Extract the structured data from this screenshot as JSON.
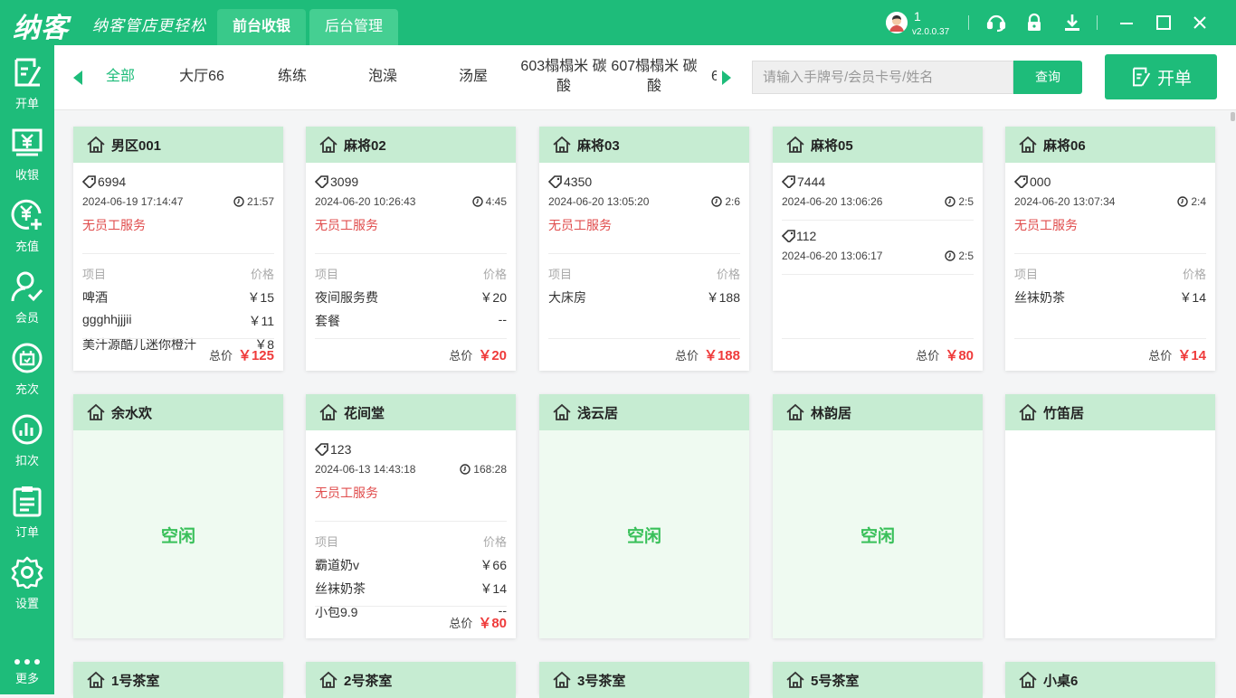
{
  "app": {
    "logo": "纳客",
    "slogan": "纳客管店更轻松",
    "version": "v2.0.0.37",
    "user": "1"
  },
  "main_tabs": [
    {
      "label": "前台收银"
    },
    {
      "label": "后台管理"
    }
  ],
  "sidebar": {
    "items": [
      {
        "label": "开单",
        "icon": "edit-note-icon"
      },
      {
        "label": "收银",
        "icon": "cashier-icon"
      },
      {
        "label": "充值",
        "icon": "recharge-icon"
      },
      {
        "label": "会员",
        "icon": "member-icon"
      },
      {
        "label": "充次",
        "icon": "recharge-times-icon"
      },
      {
        "label": "扣次",
        "icon": "deduct-times-icon"
      },
      {
        "label": "订单",
        "icon": "orders-icon"
      },
      {
        "label": "设置",
        "icon": "settings-icon"
      },
      {
        "label": "更多",
        "icon": "more-icon"
      }
    ]
  },
  "categories": [
    {
      "label": "全部"
    },
    {
      "label": "大厅66"
    },
    {
      "label": "练练"
    },
    {
      "label": "泡澡"
    },
    {
      "label": "汤屋"
    },
    {
      "label": "603榻榻米 碳酸"
    },
    {
      "label": "607榻榻米 碳酸"
    },
    {
      "label": "6"
    }
  ],
  "search": {
    "placeholder": "请输入手牌号/会员卡号/姓名",
    "button": "查询"
  },
  "open_order": {
    "label": "开单"
  },
  "labels": {
    "item": "项目",
    "price": "价格",
    "total": "总价",
    "no_staff": "无员工服务",
    "idle": "空闲"
  },
  "cards": [
    {
      "name": "男区001",
      "tag": "6994",
      "datetime": "2024-06-19 17:14:47",
      "duration": "21:57",
      "staff": "无员工服务",
      "items": [
        {
          "name": "啤酒",
          "price": "￥15"
        },
        {
          "name": "ggghhjjjii",
          "price": "￥11"
        },
        {
          "name": "美汁源酷儿迷你橙汁",
          "price": "￥8"
        }
      ],
      "total": "￥125"
    },
    {
      "name": "麻将02",
      "tag": "3099",
      "datetime": "2024-06-20 10:26:43",
      "duration": "4:45",
      "staff": "无员工服务",
      "items": [
        {
          "name": "夜间服务费",
          "price": "￥20"
        },
        {
          "name": "套餐",
          "price": "--"
        }
      ],
      "total": "￥20"
    },
    {
      "name": "麻将03",
      "tag": "4350",
      "datetime": "2024-06-20 13:05:20",
      "duration": "2:6",
      "staff": "无员工服务",
      "items": [
        {
          "name": "大床房",
          "price": "￥188"
        }
      ],
      "total": "￥188"
    },
    {
      "name": "麻将05",
      "tag": "7444",
      "datetime": "2024-06-20 13:06:26",
      "duration": "2:5",
      "tag2": "112",
      "datetime2": "2024-06-20 13:06:17",
      "duration2": "2:5",
      "total": "￥80"
    },
    {
      "name": "麻将06",
      "tag": "000",
      "datetime": "2024-06-20 13:07:34",
      "duration": "2:4",
      "staff": "无员工服务",
      "items": [
        {
          "name": "丝袜奶茶",
          "price": "￥14"
        }
      ],
      "total": "￥14"
    },
    {
      "name": "余水欢",
      "status": "空闲"
    },
    {
      "name": "花间堂",
      "tag": "123",
      "datetime": "2024-06-13 14:43:18",
      "duration": "168:28",
      "staff": "无员工服务",
      "items": [
        {
          "name": "霸道奶v",
          "price": "￥66"
        },
        {
          "name": "丝袜奶茶",
          "price": "￥14"
        },
        {
          "name": "小包9.9",
          "price": "--"
        }
      ],
      "total": "￥80"
    },
    {
      "name": "浅云居",
      "status": "空闲"
    },
    {
      "name": "林韵居",
      "status": "空闲"
    },
    {
      "name": "竹笛居",
      "status": ""
    },
    {
      "name": "1号茶室"
    },
    {
      "name": "2号茶室"
    },
    {
      "name": "3号茶室"
    },
    {
      "name": "5号茶室"
    },
    {
      "name": "小桌6"
    }
  ]
}
